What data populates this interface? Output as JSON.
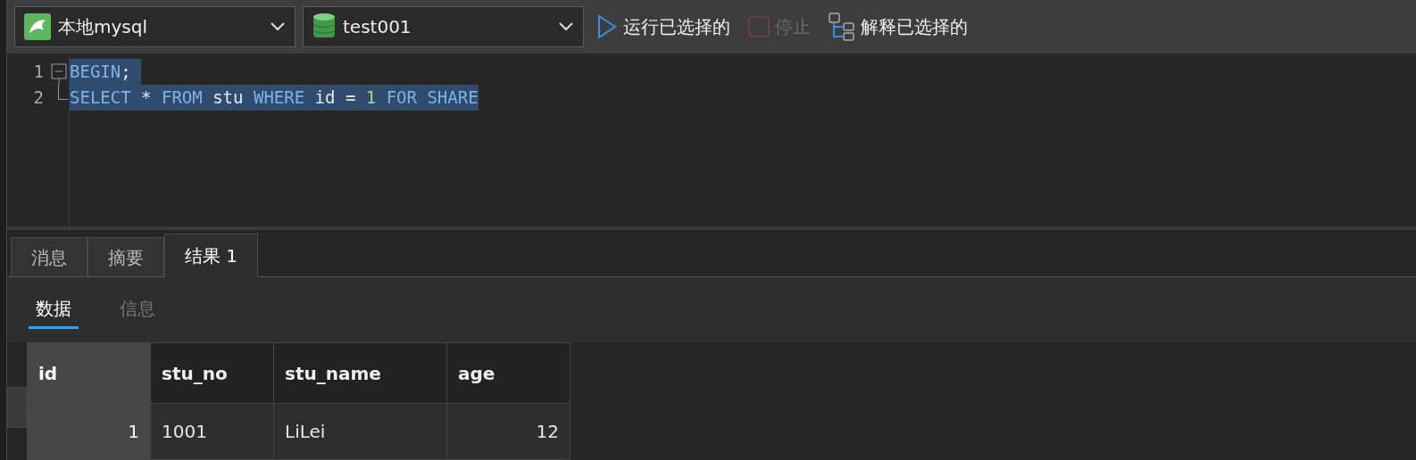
{
  "toolbar": {
    "connection": {
      "label": "本地mysql"
    },
    "database": {
      "label": "test001"
    },
    "buttons": [
      {
        "kind": "run",
        "label": "运行已选择的",
        "disabled": false
      },
      {
        "kind": "stop",
        "label": "停止",
        "disabled": true
      },
      {
        "kind": "explain",
        "label": "解释已选择的",
        "disabled": false
      }
    ]
  },
  "editor": {
    "lines": [
      {
        "number": "1",
        "selected": true,
        "tokens": [
          {
            "kind": "keyword",
            "text": "BEGIN"
          },
          {
            "kind": "plain",
            "text": "; "
          }
        ]
      },
      {
        "number": "2",
        "selected": true,
        "tokens": [
          {
            "kind": "keyword",
            "text": "SELECT"
          },
          {
            "kind": "plain",
            "text": " * "
          },
          {
            "kind": "keyword",
            "text": "FROM"
          },
          {
            "kind": "plain",
            "text": " stu "
          },
          {
            "kind": "keyword",
            "text": "WHERE"
          },
          {
            "kind": "plain",
            "text": " id = "
          },
          {
            "kind": "number",
            "text": "1"
          },
          {
            "kind": "keyword",
            "text": " FOR SHARE"
          }
        ]
      }
    ]
  },
  "result_tabs": [
    {
      "label": "消息",
      "selected": false
    },
    {
      "label": "摘要",
      "selected": false
    },
    {
      "label": "结果 1",
      "selected": true
    }
  ],
  "sub_tabs": [
    {
      "label": "数据",
      "selected": true
    },
    {
      "label": "信息",
      "selected": false
    }
  ],
  "table": {
    "columns": [
      {
        "label": "id",
        "selected": true
      },
      {
        "label": "stu_no",
        "selected": false
      },
      {
        "label": "stu_name",
        "selected": false
      },
      {
        "label": "age",
        "selected": false
      }
    ],
    "rows": [
      {
        "cells": [
          "1",
          "1001",
          "LiLei",
          "12"
        ]
      }
    ]
  }
}
